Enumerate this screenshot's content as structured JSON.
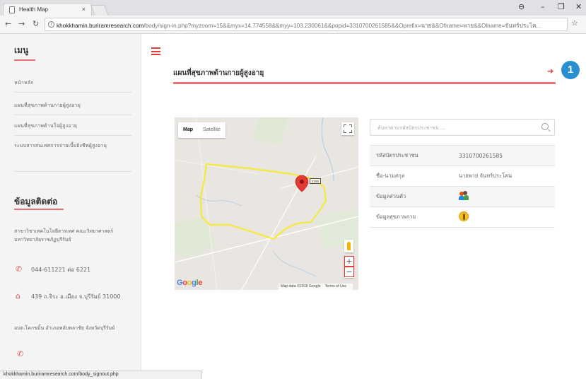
{
  "browser": {
    "tab_title": "Health Map",
    "tab_close": "×",
    "url_host": "khokkhamin.buriramresearch.com",
    "url_rest": "/body/sign-in.php?myzoom=15&&myx=14.774558&&myy=103.230061&&popid=3310700261585&&Oprefix=นาย&&Ofname=พาย&&Olname=จันทร์ประโค...",
    "status_url": "khokkhamin.buriramresearch.com/body_signout.php",
    "window_controls": [
      "⊖",
      "–",
      "❐",
      "✕"
    ]
  },
  "sidebar": {
    "menu_heading": "เมนู",
    "items": [
      {
        "label": "หน้าหลัก"
      },
      {
        "label": "แผนที่สุขภาพด้านกายผู้สูงอายุ"
      },
      {
        "label": "แผนที่สุขภาพด้านใจผู้สูงอายุ"
      },
      {
        "label": "ระบบสารสนเทศการจ่ายเบี้ยยังชีพผู้สูงอายุ"
      }
    ],
    "contact_heading": "ข้อมูลติดต่อ",
    "contact_org": "สาขาวิชาเทคโนโลยีสารเทศ คณะวิทยาศาสตร์ มหาวิทยาลัยราชภัฏบุรีรัมย์",
    "phone": "044-611221 ต่อ 6221",
    "address": "439 ถ.จิระ อ.เมือง จ.บุรีรัมย์ 31000",
    "org2": "อบต.โคกขมิ้น อำเภอพลับพลาชัย จังหวัดบุรีรัมย์"
  },
  "main": {
    "title": "แผนที่สุขภาพด้านกายผู้สูงอายุ",
    "callout_number": "1",
    "search_placeholder": "ค้นหาตามรหัสบัตรประชาชน ...",
    "rows": [
      {
        "label": "รหัสบัตรประชาชน",
        "value": "3310700261585"
      },
      {
        "label": "ชื่อ-นามสกุล",
        "value": "นายพาย จันทร์ประโคน"
      },
      {
        "label": "ข้อมูลส่วนตัว",
        "icon": "personal-info-icon"
      },
      {
        "label": "ข้อมูลสุขภาพกาย",
        "icon": "physical-health-icon"
      }
    ]
  },
  "map": {
    "type_map": "Map",
    "type_satellite": "Satellite",
    "road_number": "2165",
    "zoom_in": "+",
    "zoom_out": "−",
    "logo": "Google",
    "map_data": "Map data ©2018 Google",
    "terms": "Terms of Use",
    "accent_boundary": "#f4e93c",
    "marker_color": "#e53935"
  },
  "colors": {
    "accent": "#e57373",
    "link": "#d9534f",
    "callout": "#2a8fd0"
  }
}
